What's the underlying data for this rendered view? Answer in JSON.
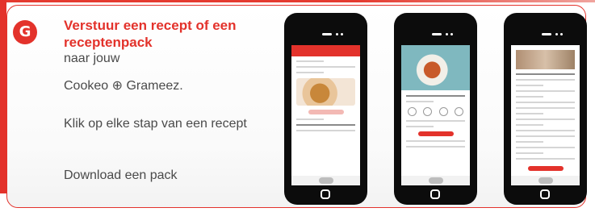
{
  "step": {
    "badge": "G",
    "title": "Verstuur een recept of een receptenpack",
    "lines": [
      "naar jouw",
      "Cookeo ⊕ Grameez.",
      "Klik op elke stap van een recept",
      "Download een pack"
    ]
  },
  "phones": [
    {
      "screen": "recipe-list"
    },
    {
      "screen": "recipe-detail"
    },
    {
      "screen": "ingredients-list"
    }
  ],
  "colors": {
    "accent": "#e3322b",
    "text": "#4a4a4a"
  }
}
